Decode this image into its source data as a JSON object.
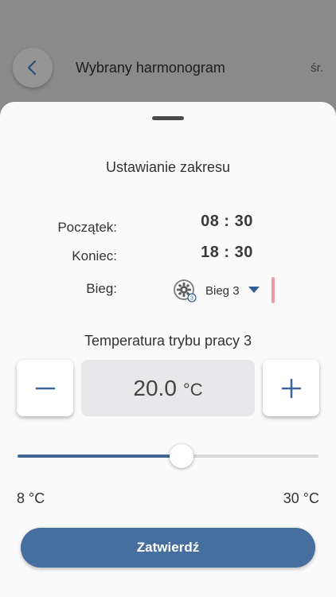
{
  "header": {
    "title": "Wybrany harmonogram",
    "day": "śr."
  },
  "sheet": {
    "title": "Ustawianie zakresu",
    "start_label": "Początek:",
    "start_value": "08 : 30",
    "end_label": "Koniec:",
    "end_value": "18 : 30",
    "gear_label": "Bieg:",
    "gear_value": "Bieg 3",
    "gear_badge": "3",
    "temperature_title": "Temperatura trybu pracy 3",
    "temperature_value": "20.0",
    "temperature_unit": "°C",
    "slider": {
      "min": 8,
      "max": 30,
      "value": 20.0
    },
    "range_min_label": "8 °C",
    "range_max_label": "30 °C",
    "confirm_label": "Zatwierdź"
  },
  "icons": {
    "back": "chevron-left-icon",
    "gear": "fan-gear-icon",
    "minus": "minus-icon",
    "plus": "plus-icon",
    "dropdown": "caret-down-icon"
  },
  "colors": {
    "accent": "#2f5f96",
    "button": "#466f9f",
    "indicator": "#ee9aa6"
  }
}
